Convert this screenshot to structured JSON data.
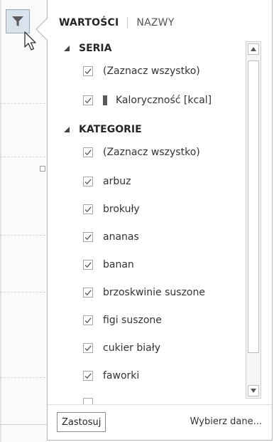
{
  "tabs": {
    "values": "WARTOŚCI",
    "names": "NAZWY"
  },
  "series_section": {
    "header": "SERIA",
    "select_all": "(Zaznacz wszystko)",
    "items": [
      "Kaloryczność [kcal]"
    ]
  },
  "categories_section": {
    "header": "KATEGORIE",
    "select_all": "(Zaznacz wszystko)",
    "items": [
      "arbuz",
      "brokuły",
      "ananas",
      "banan",
      "brzoskwinie suszone",
      "figi suszone",
      "cukier biały",
      "faworki"
    ]
  },
  "footer": {
    "apply": "Zastosuj",
    "select_data": "Wybierz dane..."
  },
  "colors": {
    "filter_button_bg": "#d9e3ee",
    "series_swatch": "#595959"
  }
}
